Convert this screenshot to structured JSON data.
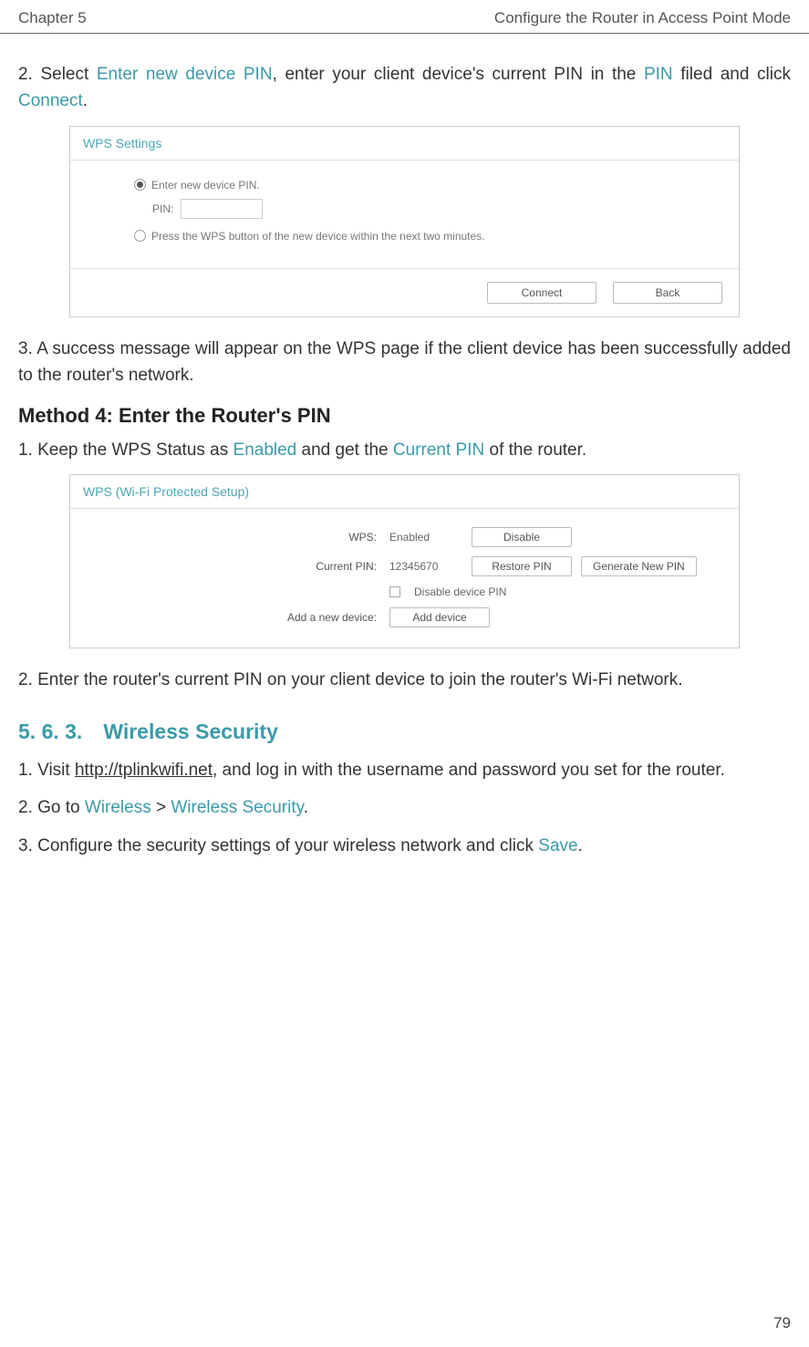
{
  "header": {
    "left": "Chapter 5",
    "right": "Configure the Router in Access Point Mode"
  },
  "steps_a": {
    "s2_a": "2. Select ",
    "s2_blue1": "Enter new device PIN",
    "s2_b": ", enter your client device's current PIN in the ",
    "s2_blue2": "PIN",
    "s2_c": " filed and click ",
    "s2_blue3": "Connect",
    "s2_d": ".",
    "s3": "3. A success message will appear on the WPS page if the client device has been successfully added to the router's network."
  },
  "shot1": {
    "title": "WPS Settings",
    "radio1": "Enter new device PIN.",
    "pin_label": "PIN:",
    "radio2": "Press the WPS button of the new device within the next two minutes.",
    "btn_connect": "Connect",
    "btn_back": "Back"
  },
  "method4_heading": "Method 4: Enter the Router's PIN",
  "steps_b": {
    "s1_a": "1. Keep the WPS Status as ",
    "s1_blue1": "Enabled",
    "s1_b": " and get the ",
    "s1_blue2": "Current PIN",
    "s1_c": " of the router.",
    "s2": "2. Enter the router's current PIN on your client device to join the router's Wi-Fi network."
  },
  "shot2": {
    "title": "WPS (Wi-Fi Protected Setup)",
    "label_wps": "WPS:",
    "val_wps": "Enabled",
    "btn_disable": "Disable",
    "label_pin": "Current PIN:",
    "val_pin": "12345670",
    "btn_restore": "Restore PIN",
    "btn_generate": "Generate New PIN",
    "chk_label": "Disable device PIN",
    "label_add": "Add a new device:",
    "btn_add": "Add device"
  },
  "section_heading": "5. 6. 3. Wireless Security",
  "steps_c": {
    "s1_a": "1. Visit ",
    "s1_link": "http://tplinkwifi.net",
    "s1_b": ", and log in with the username and password you set for the router.",
    "s2_a": "2. Go to ",
    "s2_blue1": "Wireless",
    "s2_b": " > ",
    "s2_blue2": "Wireless Security",
    "s2_c": ".",
    "s3_a": "3. Configure the security settings of your wireless network and click ",
    "s3_blue1": "Save",
    "s3_b": "."
  },
  "page_number": "79"
}
